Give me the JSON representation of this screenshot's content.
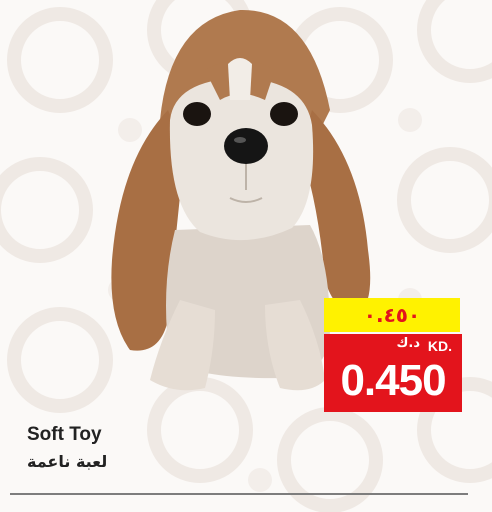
{
  "product": {
    "name_en": "Soft Toy",
    "name_ar": "لعبة ناعمة"
  },
  "price": {
    "arabic_numerals": "٠.٤٥٠",
    "currency_ar": "د.ك",
    "currency_en": "KD.",
    "value": "0.450"
  },
  "colors": {
    "tag_yellow": "#fff200",
    "tag_red": "#e3141c"
  },
  "image": {
    "subject": "plush-basset-hound-dog-icon"
  }
}
